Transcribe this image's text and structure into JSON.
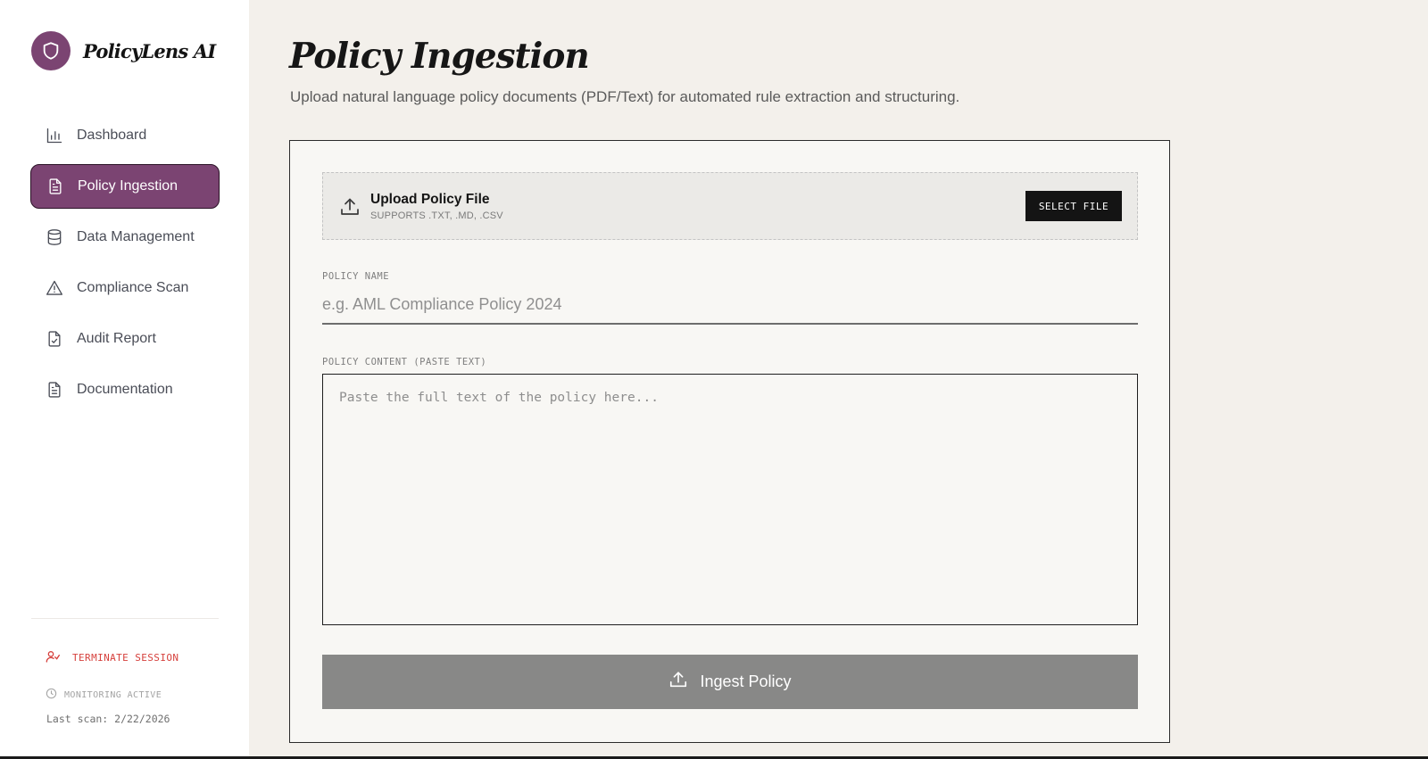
{
  "brand": {
    "name": "PolicyLens AI",
    "logo_icon": "shield-icon",
    "accent": "#7b4472"
  },
  "sidebar": {
    "items": [
      {
        "label": "Dashboard",
        "icon": "bar-chart-icon",
        "active": false
      },
      {
        "label": "Policy Ingestion",
        "icon": "file-text-icon",
        "active": true
      },
      {
        "label": "Data Management",
        "icon": "database-icon",
        "active": false
      },
      {
        "label": "Compliance Scan",
        "icon": "alert-triangle-icon",
        "active": false
      },
      {
        "label": "Audit Report",
        "icon": "file-check-icon",
        "active": false
      },
      {
        "label": "Documentation",
        "icon": "file-text-icon",
        "active": false
      }
    ],
    "terminate_label": "TERMINATE SESSION",
    "terminate_color": "#d6413d",
    "monitoring_label": "MONITORING ACTIVE",
    "last_scan": "Last scan: 2/22/2026"
  },
  "page": {
    "title": "Policy Ingestion",
    "subtitle": "Upload natural language policy documents (PDF/Text) for automated rule extraction and structuring."
  },
  "upload": {
    "title": "Upload Policy File",
    "hint": "SUPPORTS .TXT, .MD, .CSV",
    "button_label": "SELECT FILE"
  },
  "form": {
    "name_label": "POLICY NAME",
    "name_placeholder": "e.g. AML Compliance Policy 2024",
    "name_value": "",
    "content_label": "POLICY CONTENT (PASTE TEXT)",
    "content_placeholder": "Paste the full text of the policy here...",
    "content_value": "",
    "submit_label": "Ingest Policy"
  }
}
